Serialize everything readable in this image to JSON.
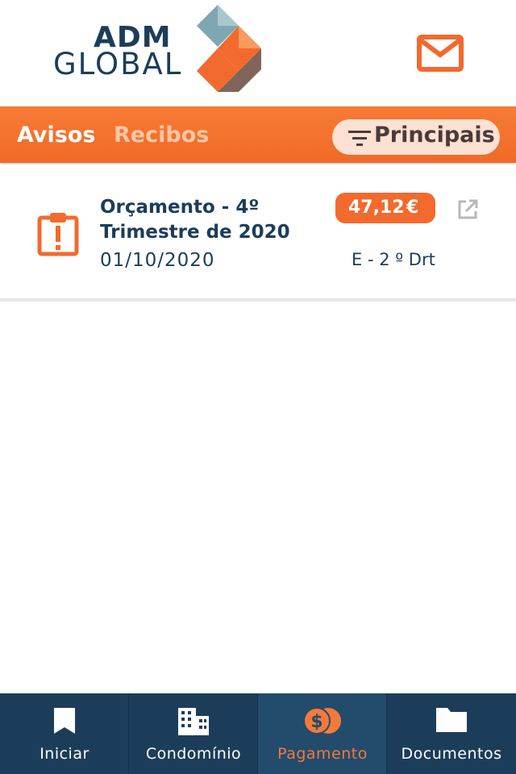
{
  "header": {
    "logo_line1": "ADM",
    "logo_line2": "GLOBAL",
    "mail_icon": "mail-icon"
  },
  "tabs": [
    {
      "label": "Avisos",
      "active": true
    },
    {
      "label": "Recibos",
      "active": false
    }
  ],
  "filter": {
    "label": "Principais",
    "icon": "filter-icon"
  },
  "notices": [
    {
      "title": "Orçamento - 4º Trimestre de 2020",
      "date": "01/10/2020",
      "amount": "47,12",
      "currency": "€",
      "unit": "E - 2 º Drt",
      "icon": "clipboard-alert-icon",
      "action_icon": "open-external-icon"
    }
  ],
  "bottom_nav": [
    {
      "label": "Iniciar",
      "icon": "bookmark-icon",
      "active": false
    },
    {
      "label": "Condomínio",
      "icon": "building-icon",
      "active": false
    },
    {
      "label": "Pagamento",
      "icon": "coins-icon",
      "active": true
    },
    {
      "label": "Documentos",
      "icon": "folder-icon",
      "active": false
    }
  ],
  "colors": {
    "brand_navy": "#1c3d5a",
    "brand_orange": "#f26a2e",
    "active_nav_label": "#f47a3b"
  }
}
